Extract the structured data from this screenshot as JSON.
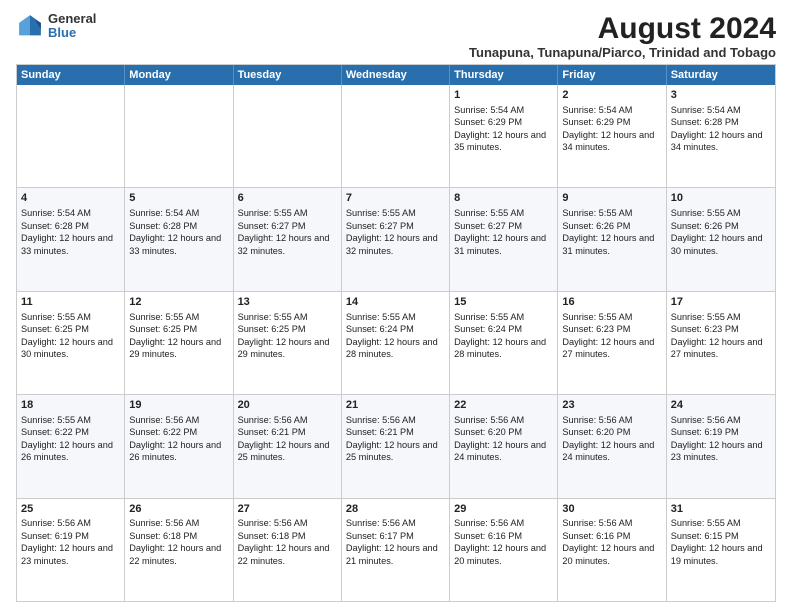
{
  "logo": {
    "general": "General",
    "blue": "Blue"
  },
  "title": "August 2024",
  "subtitle": "Tunapuna, Tunapuna/Piarco, Trinidad and Tobago",
  "header_days": [
    "Sunday",
    "Monday",
    "Tuesday",
    "Wednesday",
    "Thursday",
    "Friday",
    "Saturday"
  ],
  "weeks": [
    [
      {
        "day": "",
        "text": ""
      },
      {
        "day": "",
        "text": ""
      },
      {
        "day": "",
        "text": ""
      },
      {
        "day": "",
        "text": ""
      },
      {
        "day": "1",
        "text": "Sunrise: 5:54 AM\nSunset: 6:29 PM\nDaylight: 12 hours and 35 minutes."
      },
      {
        "day": "2",
        "text": "Sunrise: 5:54 AM\nSunset: 6:29 PM\nDaylight: 12 hours and 34 minutes."
      },
      {
        "day": "3",
        "text": "Sunrise: 5:54 AM\nSunset: 6:28 PM\nDaylight: 12 hours and 34 minutes."
      }
    ],
    [
      {
        "day": "4",
        "text": "Sunrise: 5:54 AM\nSunset: 6:28 PM\nDaylight: 12 hours and 33 minutes."
      },
      {
        "day": "5",
        "text": "Sunrise: 5:54 AM\nSunset: 6:28 PM\nDaylight: 12 hours and 33 minutes."
      },
      {
        "day": "6",
        "text": "Sunrise: 5:55 AM\nSunset: 6:27 PM\nDaylight: 12 hours and 32 minutes."
      },
      {
        "day": "7",
        "text": "Sunrise: 5:55 AM\nSunset: 6:27 PM\nDaylight: 12 hours and 32 minutes."
      },
      {
        "day": "8",
        "text": "Sunrise: 5:55 AM\nSunset: 6:27 PM\nDaylight: 12 hours and 31 minutes."
      },
      {
        "day": "9",
        "text": "Sunrise: 5:55 AM\nSunset: 6:26 PM\nDaylight: 12 hours and 31 minutes."
      },
      {
        "day": "10",
        "text": "Sunrise: 5:55 AM\nSunset: 6:26 PM\nDaylight: 12 hours and 30 minutes."
      }
    ],
    [
      {
        "day": "11",
        "text": "Sunrise: 5:55 AM\nSunset: 6:25 PM\nDaylight: 12 hours and 30 minutes."
      },
      {
        "day": "12",
        "text": "Sunrise: 5:55 AM\nSunset: 6:25 PM\nDaylight: 12 hours and 29 minutes."
      },
      {
        "day": "13",
        "text": "Sunrise: 5:55 AM\nSunset: 6:25 PM\nDaylight: 12 hours and 29 minutes."
      },
      {
        "day": "14",
        "text": "Sunrise: 5:55 AM\nSunset: 6:24 PM\nDaylight: 12 hours and 28 minutes."
      },
      {
        "day": "15",
        "text": "Sunrise: 5:55 AM\nSunset: 6:24 PM\nDaylight: 12 hours and 28 minutes."
      },
      {
        "day": "16",
        "text": "Sunrise: 5:55 AM\nSunset: 6:23 PM\nDaylight: 12 hours and 27 minutes."
      },
      {
        "day": "17",
        "text": "Sunrise: 5:55 AM\nSunset: 6:23 PM\nDaylight: 12 hours and 27 minutes."
      }
    ],
    [
      {
        "day": "18",
        "text": "Sunrise: 5:55 AM\nSunset: 6:22 PM\nDaylight: 12 hours and 26 minutes."
      },
      {
        "day": "19",
        "text": "Sunrise: 5:56 AM\nSunset: 6:22 PM\nDaylight: 12 hours and 26 minutes."
      },
      {
        "day": "20",
        "text": "Sunrise: 5:56 AM\nSunset: 6:21 PM\nDaylight: 12 hours and 25 minutes."
      },
      {
        "day": "21",
        "text": "Sunrise: 5:56 AM\nSunset: 6:21 PM\nDaylight: 12 hours and 25 minutes."
      },
      {
        "day": "22",
        "text": "Sunrise: 5:56 AM\nSunset: 6:20 PM\nDaylight: 12 hours and 24 minutes."
      },
      {
        "day": "23",
        "text": "Sunrise: 5:56 AM\nSunset: 6:20 PM\nDaylight: 12 hours and 24 minutes."
      },
      {
        "day": "24",
        "text": "Sunrise: 5:56 AM\nSunset: 6:19 PM\nDaylight: 12 hours and 23 minutes."
      }
    ],
    [
      {
        "day": "25",
        "text": "Sunrise: 5:56 AM\nSunset: 6:19 PM\nDaylight: 12 hours and 23 minutes."
      },
      {
        "day": "26",
        "text": "Sunrise: 5:56 AM\nSunset: 6:18 PM\nDaylight: 12 hours and 22 minutes."
      },
      {
        "day": "27",
        "text": "Sunrise: 5:56 AM\nSunset: 6:18 PM\nDaylight: 12 hours and 22 minutes."
      },
      {
        "day": "28",
        "text": "Sunrise: 5:56 AM\nSunset: 6:17 PM\nDaylight: 12 hours and 21 minutes."
      },
      {
        "day": "29",
        "text": "Sunrise: 5:56 AM\nSunset: 6:16 PM\nDaylight: 12 hours and 20 minutes."
      },
      {
        "day": "30",
        "text": "Sunrise: 5:56 AM\nSunset: 6:16 PM\nDaylight: 12 hours and 20 minutes."
      },
      {
        "day": "31",
        "text": "Sunrise: 5:55 AM\nSunset: 6:15 PM\nDaylight: 12 hours and 19 minutes."
      }
    ]
  ]
}
